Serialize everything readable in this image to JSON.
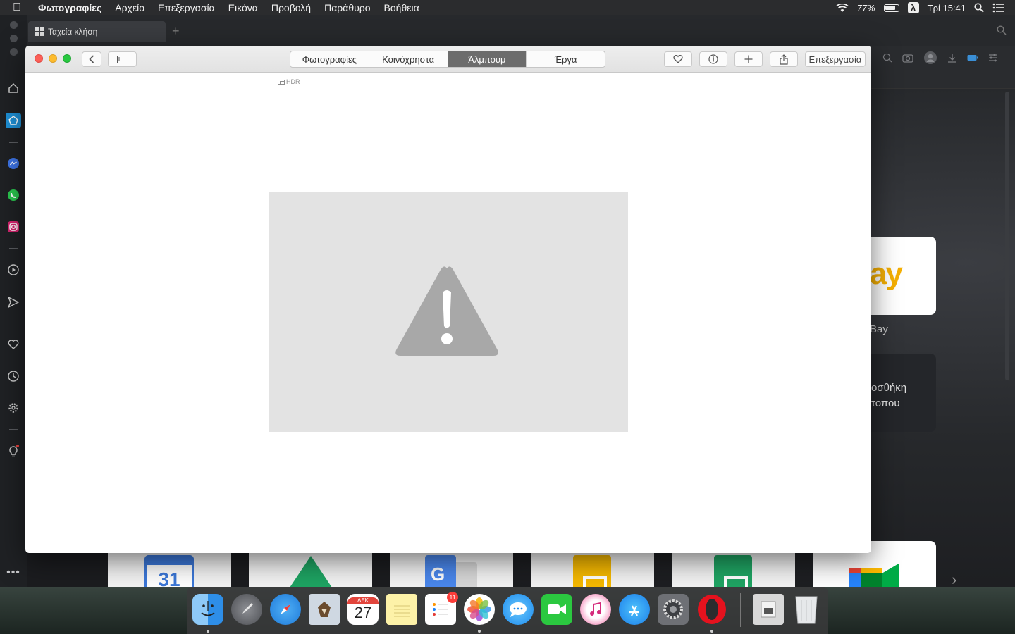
{
  "menubar": {
    "app_name": "Φωτογραφίες",
    "items": [
      "Αρχείο",
      "Επεξεργασία",
      "Εικόνα",
      "Προβολή",
      "Παράθυρο",
      "Βοήθεια"
    ],
    "battery_percent": "77%",
    "input_source": "λ",
    "clock": "Τρί 15:41"
  },
  "browser": {
    "tab_title": "Ταχεία κλήση",
    "speed_dial": {
      "ebay_logo": "ay",
      "ebay_label": "Bay",
      "add_tile_line1": "οσθήκη",
      "add_tile_line2": "τοπου"
    }
  },
  "photos": {
    "segments": [
      {
        "label": "Φωτογραφίες",
        "active": false
      },
      {
        "label": "Κοινόχρηστα",
        "active": false
      },
      {
        "label": "Άλμπουμ",
        "active": true
      },
      {
        "label": "Έργα",
        "active": false
      }
    ],
    "edit_button": "Επεξεργασία",
    "hdr_badge": "HDR"
  },
  "dock": {
    "calendar_month": "ΔΕΚ",
    "calendar_day": "27",
    "reminders_badge": "11",
    "gcal_day": "31",
    "gtrans_letter": "G"
  }
}
